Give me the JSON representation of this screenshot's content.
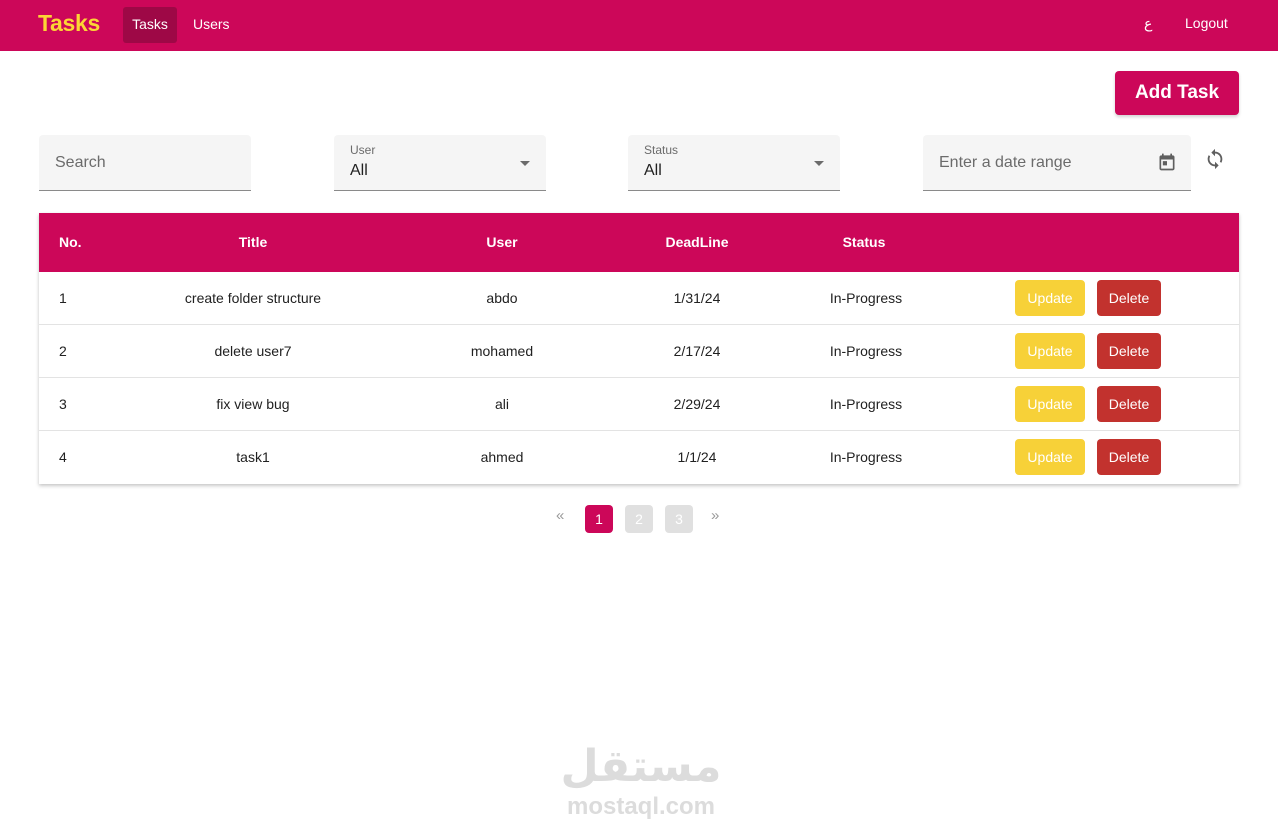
{
  "navbar": {
    "brand": "Tasks",
    "links": [
      {
        "label": "Tasks",
        "active": true
      },
      {
        "label": "Users",
        "active": false
      }
    ],
    "lang_toggle": "ع",
    "logout": "Logout"
  },
  "actions": {
    "add_task_label": "Add Task"
  },
  "filters": {
    "search_placeholder": "Search",
    "user": {
      "label": "User",
      "value": "All"
    },
    "status": {
      "label": "Status",
      "value": "All"
    },
    "date_placeholder": "Enter a date range"
  },
  "table": {
    "headers": {
      "no": "No.",
      "title": "Title",
      "user": "User",
      "deadline": "DeadLine",
      "status": "Status"
    },
    "update_label": "Update",
    "delete_label": "Delete",
    "rows": [
      {
        "no": "1",
        "title": "create folder structure",
        "user": "abdo",
        "deadline": "1/31/24",
        "status": "In-Progress"
      },
      {
        "no": "2",
        "title": "delete user7",
        "user": "mohamed",
        "deadline": "2/17/24",
        "status": "In-Progress"
      },
      {
        "no": "3",
        "title": "fix view bug",
        "user": "ali",
        "deadline": "2/29/24",
        "status": "In-Progress"
      },
      {
        "no": "4",
        "title": "task1",
        "user": "ahmed",
        "deadline": "1/1/24",
        "status": "In-Progress"
      }
    ]
  },
  "pagination": {
    "prev": "«",
    "next": "»",
    "pages": [
      "1",
      "2",
      "3"
    ],
    "current": "1"
  },
  "watermark": {
    "arabic": "مستقل",
    "latin": "mostaql.com"
  },
  "icons": {
    "calendar": "calendar-icon",
    "dropdown": "chevron-down-icon",
    "refresh": "refresh-icon"
  },
  "colors": {
    "primary": "#cc0759",
    "brand_text": "#fcd535",
    "update": "#f7d138",
    "delete": "#c2322e",
    "active_nav": "#9e0846"
  }
}
